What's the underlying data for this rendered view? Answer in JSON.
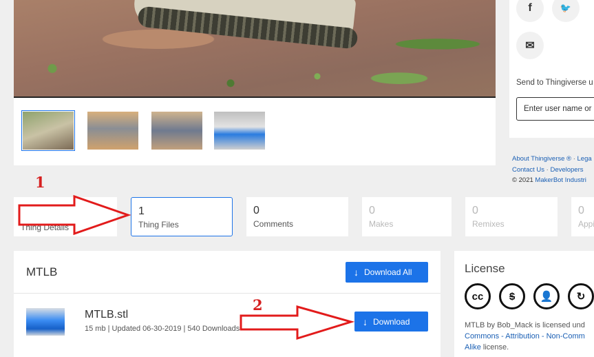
{
  "gallery": {
    "thumbnails": [
      {
        "name": "thumbnail-1",
        "selected": true
      },
      {
        "name": "thumbnail-2",
        "selected": false
      },
      {
        "name": "thumbnail-3",
        "selected": false
      },
      {
        "name": "thumbnail-4",
        "selected": false
      }
    ]
  },
  "sidebar": {
    "social_icons": [
      "facebook-icon",
      "twitter-icon",
      "mail-icon"
    ],
    "social_glyphs": {
      "facebook": "f",
      "twitter": "🐦",
      "mail": "✉"
    },
    "send_label": "Send to Thingiverse u",
    "send_placeholder": "Enter user name or",
    "footer": {
      "about": "About Thingiverse ®",
      "dot": "·",
      "legal": "Lega",
      "contact": "Contact Us",
      "developers": "Developers",
      "copyright_prefix": "©  2021",
      "makerbot": "MakerBot Industri"
    }
  },
  "tabs": [
    {
      "count": "",
      "label": "Thing Details"
    },
    {
      "count": "1",
      "label": "Thing Files"
    },
    {
      "count": "0",
      "label": "Comments"
    },
    {
      "count": "0",
      "label": "Makes"
    },
    {
      "count": "0",
      "label": "Remixes"
    },
    {
      "count": "0",
      "label": "Appi"
    }
  ],
  "files": {
    "title": "MTLB",
    "download_all": "Download All",
    "items": [
      {
        "name": "MTLB.stl",
        "meta": "15 mb | Updated 06-30-2019 | 540 Downloads",
        "download": "Download"
      }
    ]
  },
  "license": {
    "title": "License",
    "icons": [
      "cc-icon",
      "noncommercial-icon",
      "attribution-person-icon",
      "sharealike-icon"
    ],
    "icon_glyphs": {
      "cc": "cc",
      "nc": "$",
      "by": "👤",
      "sa": "↻"
    },
    "text_line1": "MTLB by  Bob_Mack  is licensed und",
    "link_line2": "Commons - Attribution - Non-Comm",
    "link_alike": "Alike",
    "text_end": "license."
  },
  "annotations": {
    "marker_1": "1",
    "marker_2": "2",
    "color": "#d62020"
  },
  "colors": {
    "accent": "#1c73e8",
    "link": "#1a5fb4",
    "background": "#efefef"
  }
}
